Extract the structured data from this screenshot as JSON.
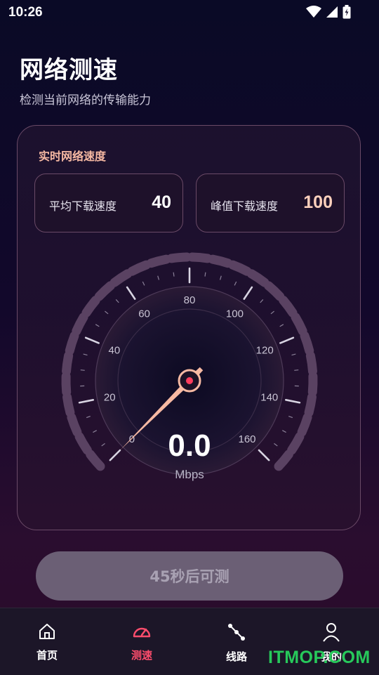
{
  "status_bar": {
    "time": "10:26"
  },
  "header": {
    "title": "网络测速",
    "subtitle": "检测当前网络的传输能力"
  },
  "card": {
    "title": "实时网络速度",
    "avg": {
      "label": "平均下载速度",
      "value": "40"
    },
    "peak": {
      "label": "峰值下载速度",
      "value": "100"
    }
  },
  "gauge": {
    "ticks": [
      "0",
      "20",
      "40",
      "60",
      "80",
      "100",
      "120",
      "140",
      "160"
    ],
    "min": 0,
    "max": 160,
    "needle_value": 0,
    "speed": "0.0",
    "unit": "Mbps"
  },
  "action": {
    "label": "45秒后可测"
  },
  "nav": {
    "items": [
      {
        "label": "首页",
        "icon": "home-icon"
      },
      {
        "label": "测速",
        "icon": "speedometer-icon"
      },
      {
        "label": "线路",
        "icon": "route-icon"
      },
      {
        "label": "我的",
        "icon": "user-icon"
      }
    ]
  },
  "watermark": "ITMOP.COM",
  "colors": {
    "accent": "#ff4d6d",
    "peach": "#fdd0bc",
    "needle": "#f6b9a3"
  }
}
